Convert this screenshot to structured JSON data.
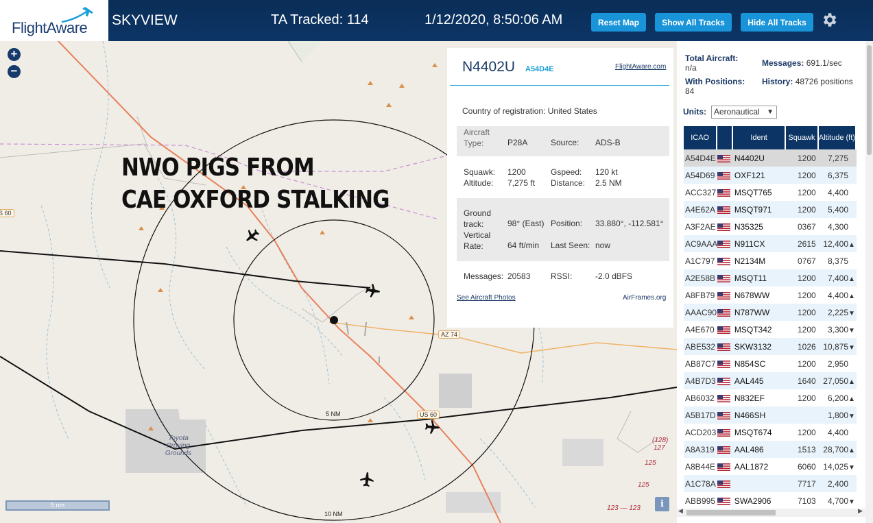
{
  "header": {
    "logo_text": "FlightAware",
    "site_name": "SKYVIEW",
    "tracked_label": "TA Tracked: 114",
    "datetime": "1/12/2020, 8:50:06 AM",
    "buttons": [
      "Reset Map",
      "Show All Tracks",
      "Hide All Tracks"
    ],
    "settings_icon": "gear-icon"
  },
  "map": {
    "zoom_in": "+",
    "zoom_out": "−",
    "overlay_line1": "NWO PIGS FROM",
    "overlay_line2": "CAE OXFORD STALKING",
    "ring_inner_label": "5 NM",
    "ring_outer_label": "10 NM",
    "road_us60_left": "S 60",
    "road_az74": "AZ 74",
    "road_us60": "US 60",
    "place": "Toyota Proving Grounds",
    "hwy_128": "(128)",
    "hwy_127": "127",
    "hwy_125": "125",
    "hwy_125b": "125",
    "hwy_123": "123 — 123",
    "scale_label": "5 nm",
    "info_button": "i"
  },
  "detail": {
    "registration": "N4402U",
    "hex": "A54D4E",
    "link": "FlightAware.com",
    "country_label": "Country of registration:",
    "country_value": "United States",
    "aircraft_type_label": "Aircraft Type:",
    "aircraft_type_value": "P28A",
    "source_label": "Source:",
    "source_value": "ADS-B",
    "squawk_label": "Squawk:",
    "squawk_value": "1200",
    "gspeed_label": "Gspeed:",
    "gspeed_value": "120 kt",
    "altitude_label": "Altitude:",
    "altitude_value": "7,275 ft",
    "distance_label": "Distance:",
    "distance_value": "2.5 NM",
    "ground_track_label": "Ground track:",
    "ground_track_value": "98° (East)",
    "position_label": "Position:",
    "position_value": "33.880°, -112.581°",
    "vrate_label": "Vertical Rate:",
    "vrate_value": "64 ft/min",
    "last_seen_label": "Last Seen:",
    "last_seen_value": "now",
    "messages_label": "Messages:",
    "messages_value": "20583",
    "rssi_label": "RSSI:",
    "rssi_value": "-2.0 dBFS",
    "photos_link": "See Aircraft Photos",
    "airframes_link": "AirFrames.org"
  },
  "sidebar": {
    "total_aircraft_label": "Total Aircraft:",
    "total_aircraft_value": "n/a",
    "messages_label": "Messages:",
    "messages_value": "691.1/sec",
    "with_positions_label": "With Positions:",
    "with_positions_value": "84",
    "history_label": "History:",
    "history_value": "48726 positions",
    "units_label": "Units:",
    "units_value": "Aeronautical",
    "columns": [
      "ICAO",
      "",
      "Ident",
      "Squawk",
      "Altitude (ft)"
    ],
    "rows": [
      {
        "icao": "A54D4E",
        "ident": "N4402U",
        "squawk": "1200",
        "alt": "7,275",
        "trend": ""
      },
      {
        "icao": "A54D69",
        "ident": "OXF121",
        "squawk": "1200",
        "alt": "6,375",
        "trend": ""
      },
      {
        "icao": "ACC327",
        "ident": "MSQT765",
        "squawk": "1200",
        "alt": "4,400",
        "trend": ""
      },
      {
        "icao": "A4E62A",
        "ident": "MSQT971",
        "squawk": "1200",
        "alt": "5,400",
        "trend": ""
      },
      {
        "icao": "A3F2AE",
        "ident": "N35325",
        "squawk": "0367",
        "alt": "4,300",
        "trend": ""
      },
      {
        "icao": "AC9AAA",
        "ident": "N911CX",
        "squawk": "2615",
        "alt": "12,400",
        "trend": "▲"
      },
      {
        "icao": "A1C797",
        "ident": "N2134M",
        "squawk": "0767",
        "alt": "8,375",
        "trend": ""
      },
      {
        "icao": "A2E58B",
        "ident": "MSQT11",
        "squawk": "1200",
        "alt": "7,400",
        "trend": "▲"
      },
      {
        "icao": "A8FB79",
        "ident": "N678WW",
        "squawk": "1200",
        "alt": "4,400",
        "trend": "▲"
      },
      {
        "icao": "AAAC90",
        "ident": "N787WW",
        "squawk": "1200",
        "alt": "2,225",
        "trend": "▼"
      },
      {
        "icao": "A4E670",
        "ident": "MSQT342",
        "squawk": "1200",
        "alt": "3,300",
        "trend": "▼"
      },
      {
        "icao": "ABE532",
        "ident": "SKW3132",
        "squawk": "1026",
        "alt": "10,875",
        "trend": "▼"
      },
      {
        "icao": "AB87C7",
        "ident": "N854SC",
        "squawk": "1200",
        "alt": "2,950",
        "trend": ""
      },
      {
        "icao": "A4B7D3",
        "ident": "AAL445",
        "squawk": "1640",
        "alt": "27,050",
        "trend": "▲"
      },
      {
        "icao": "AB6032",
        "ident": "N832EF",
        "squawk": "1200",
        "alt": "6,200",
        "trend": "▲"
      },
      {
        "icao": "A5B17D",
        "ident": "N466SH",
        "squawk": "",
        "alt": "1,800",
        "trend": "▼"
      },
      {
        "icao": "ACD203",
        "ident": "MSQT674",
        "squawk": "1200",
        "alt": "4,400",
        "trend": ""
      },
      {
        "icao": "A8A319",
        "ident": "AAL486",
        "squawk": "1513",
        "alt": "28,700",
        "trend": "▲"
      },
      {
        "icao": "A8B44E",
        "ident": "AAL1872",
        "squawk": "6060",
        "alt": "14,025",
        "trend": "▼"
      },
      {
        "icao": "A1C78A",
        "ident": "",
        "squawk": "7717",
        "alt": "2,400",
        "trend": ""
      },
      {
        "icao": "ABB995",
        "ident": "SWA2906",
        "squawk": "7103",
        "alt": "4,700",
        "trend": "▼"
      }
    ]
  },
  "colors": {
    "header_bg": "#0c3566",
    "button_bg": "#1a94d8",
    "route_orange": "#e8805a",
    "road_yellow": "#f0b46a"
  }
}
